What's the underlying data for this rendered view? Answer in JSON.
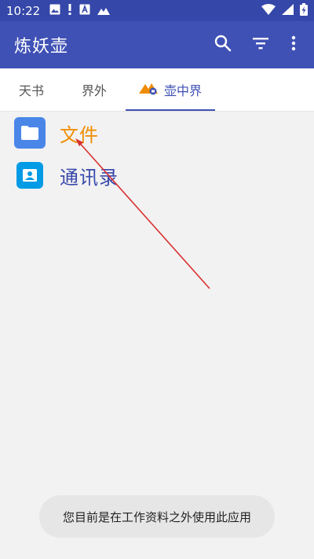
{
  "status_bar": {
    "time": "10:22",
    "left_icons": [
      "image-icon",
      "alert-icon",
      "a-box-icon",
      "mountain-icon"
    ],
    "right_icons": [
      "wifi-icon",
      "signal-icon",
      "battery-charging-icon"
    ]
  },
  "app_bar": {
    "title": "炼妖壶",
    "actions": [
      "search-icon",
      "filter-icon",
      "more-vert-icon"
    ]
  },
  "tabs": [
    {
      "label": "天书",
      "selected": false
    },
    {
      "label": "界外",
      "selected": false
    },
    {
      "label": "壶中界",
      "selected": true,
      "icon": "work-profile-badge-icon"
    }
  ],
  "list": [
    {
      "label": "文件",
      "icon": "folder-icon"
    },
    {
      "label": "通讯录",
      "icon": "contacts-icon"
    }
  ],
  "toast": {
    "text": "您目前是在工作资料之外使用此应用"
  },
  "colors": {
    "status_bar": "#3547a8",
    "app_bar": "#3f51b5",
    "accent": "#3f51b5",
    "files_label": "#f08c00",
    "annotation_arrow": "#d93030"
  }
}
